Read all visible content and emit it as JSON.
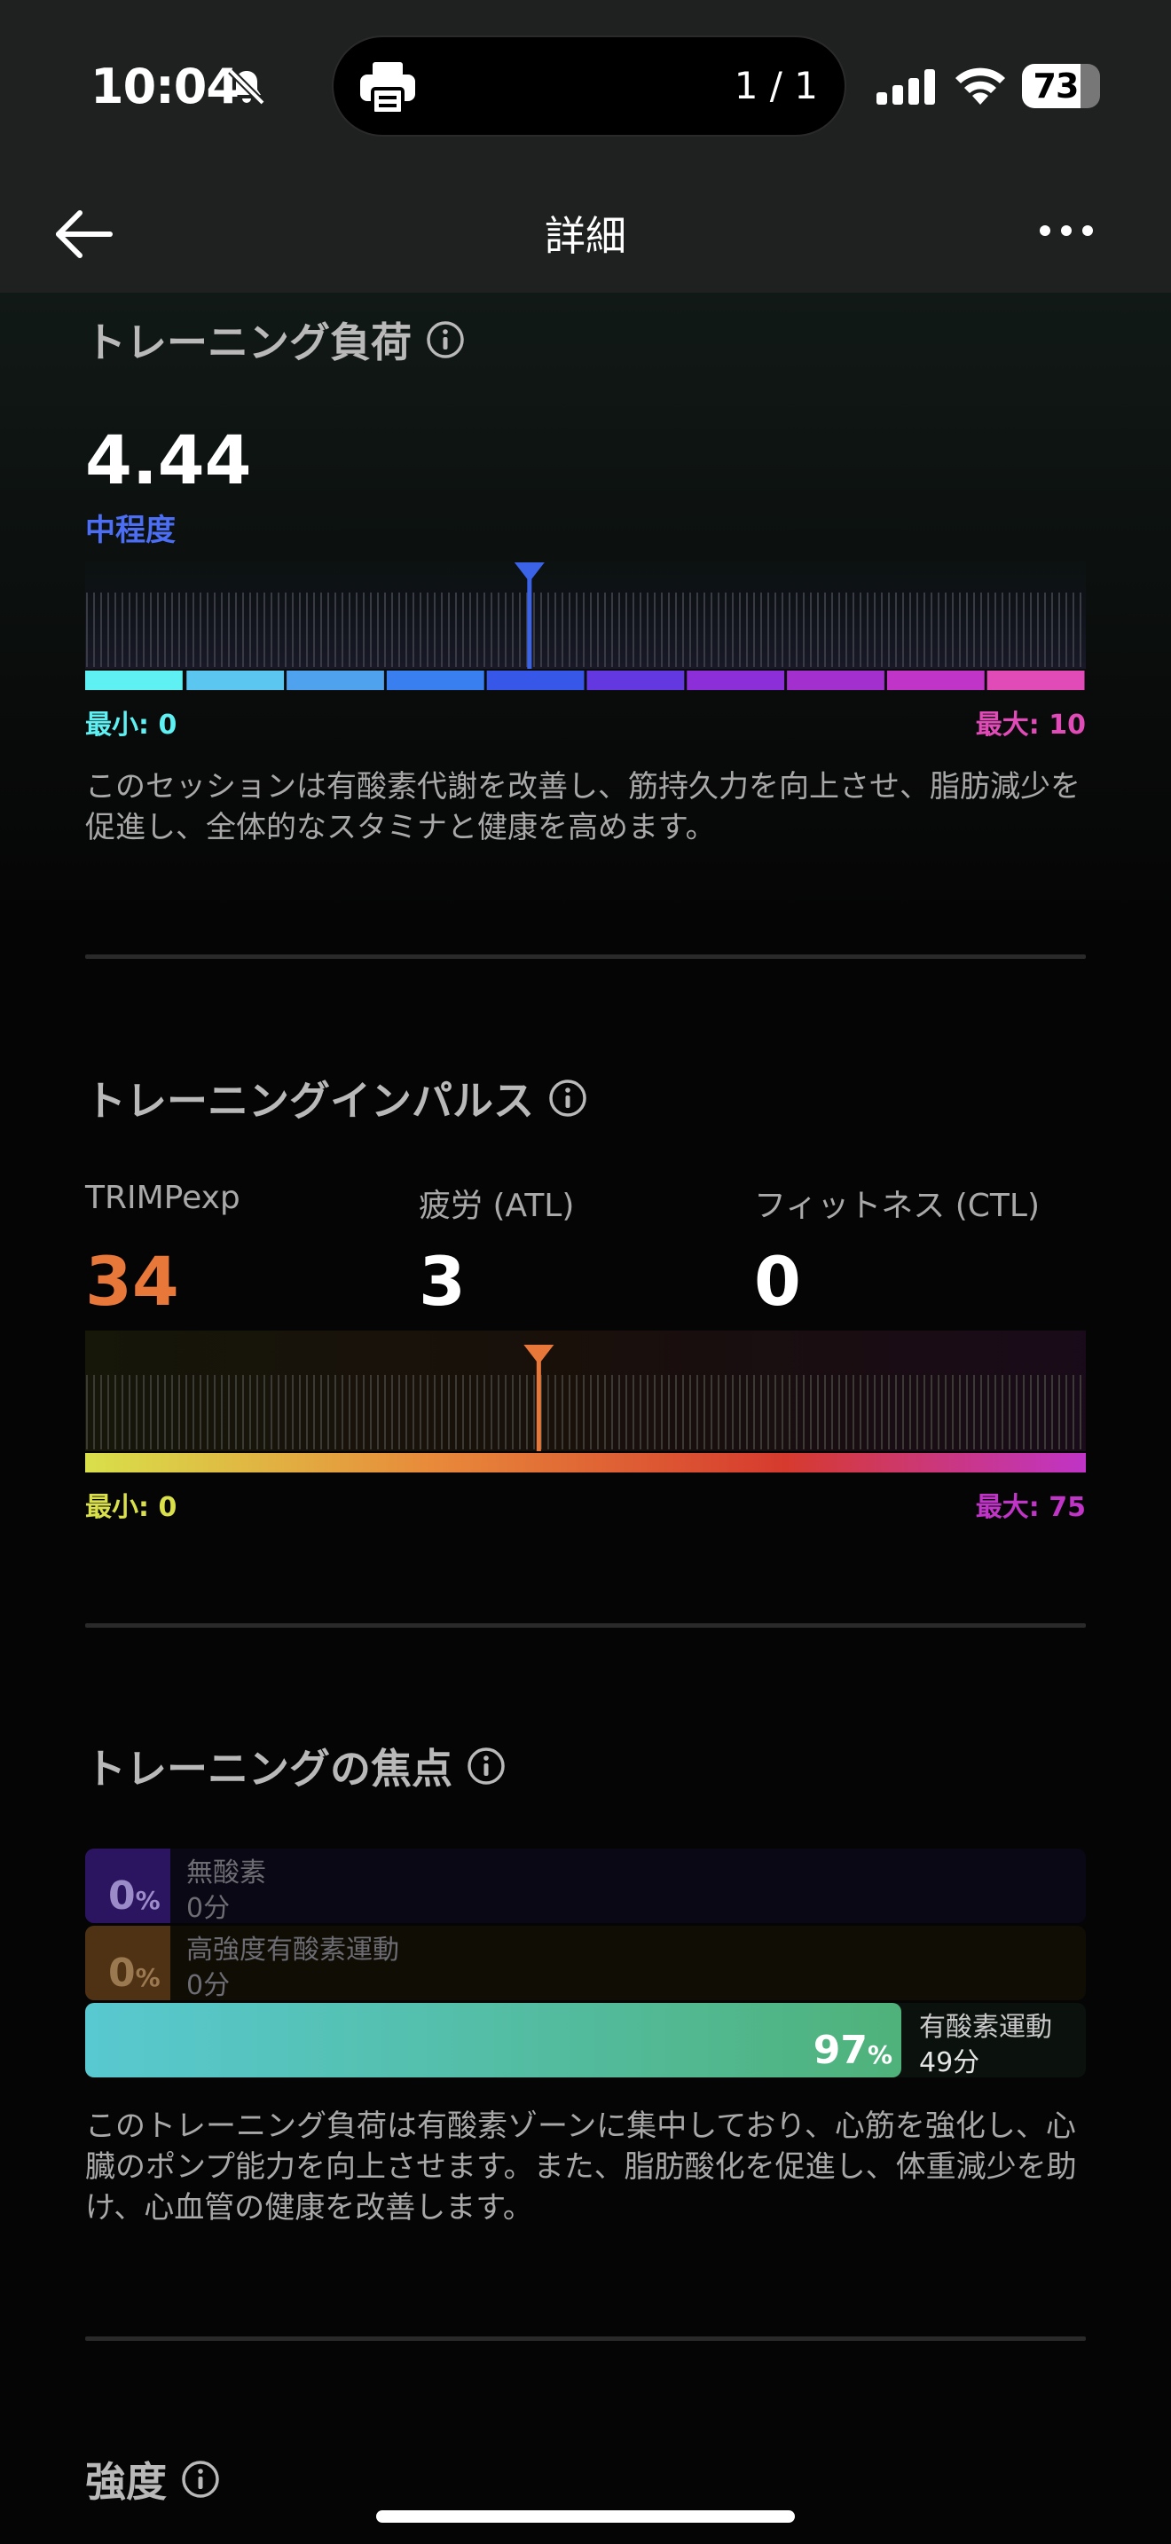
{
  "status": {
    "time": "10:04",
    "island_count": "1 / 1",
    "battery": "73"
  },
  "nav": {
    "title": "詳細"
  },
  "training_load": {
    "title": "トレーニング負荷",
    "value": "4.44",
    "level": "中程度",
    "min_label": "最小: 0",
    "max_label": "最大: 10",
    "range": [
      0,
      10
    ],
    "current": 4.44,
    "description": "このセッションは有酸素代謝を改善し、筋持久力を向上させ、脂肪減少を促進し、全体的なスタミナと健康を高めます。",
    "segment_colors": [
      "#5ef0f2",
      "#5bc6f0",
      "#4fa2ee",
      "#3a7ff0",
      "#3757e8",
      "#6438e0",
      "#8c2fd8",
      "#a42fcf",
      "#c034c7",
      "#e14bb8"
    ]
  },
  "training_impulse": {
    "title": "トレーニングインパルス",
    "metrics": [
      {
        "label": "TRIMPexp",
        "value": "34",
        "color": "#e8773a"
      },
      {
        "label": "疲労 (ATL)",
        "value": "3",
        "color": "#ffffff"
      },
      {
        "label": "フィットネス (CTL)",
        "value": "0",
        "color": "#ffffff"
      }
    ],
    "min_label": "最小: 0",
    "max_label": "最大: 75",
    "range": [
      0,
      75
    ],
    "current": 34
  },
  "training_focus": {
    "title": "トレーニングの焦点",
    "rows": [
      {
        "pct": "0",
        "unit": "%",
        "name": "無酸素",
        "duration": "0分",
        "fraction": 0
      },
      {
        "pct": "0",
        "unit": "%",
        "name": "高強度有酸素運動",
        "duration": "0分",
        "fraction": 0
      },
      {
        "pct": "97",
        "unit": "%",
        "name": "有酸素運動",
        "duration": "49分",
        "fraction": 0.97
      }
    ],
    "description": "このトレーニング負荷は有酸素ゾーンに集中しており、心筋を強化し、心臓のポンプ能力を向上させます。また、脂肪酸化を促進し、体重減少を助け、心血管の健康を改善します。"
  },
  "intensity": {
    "title": "強度"
  }
}
